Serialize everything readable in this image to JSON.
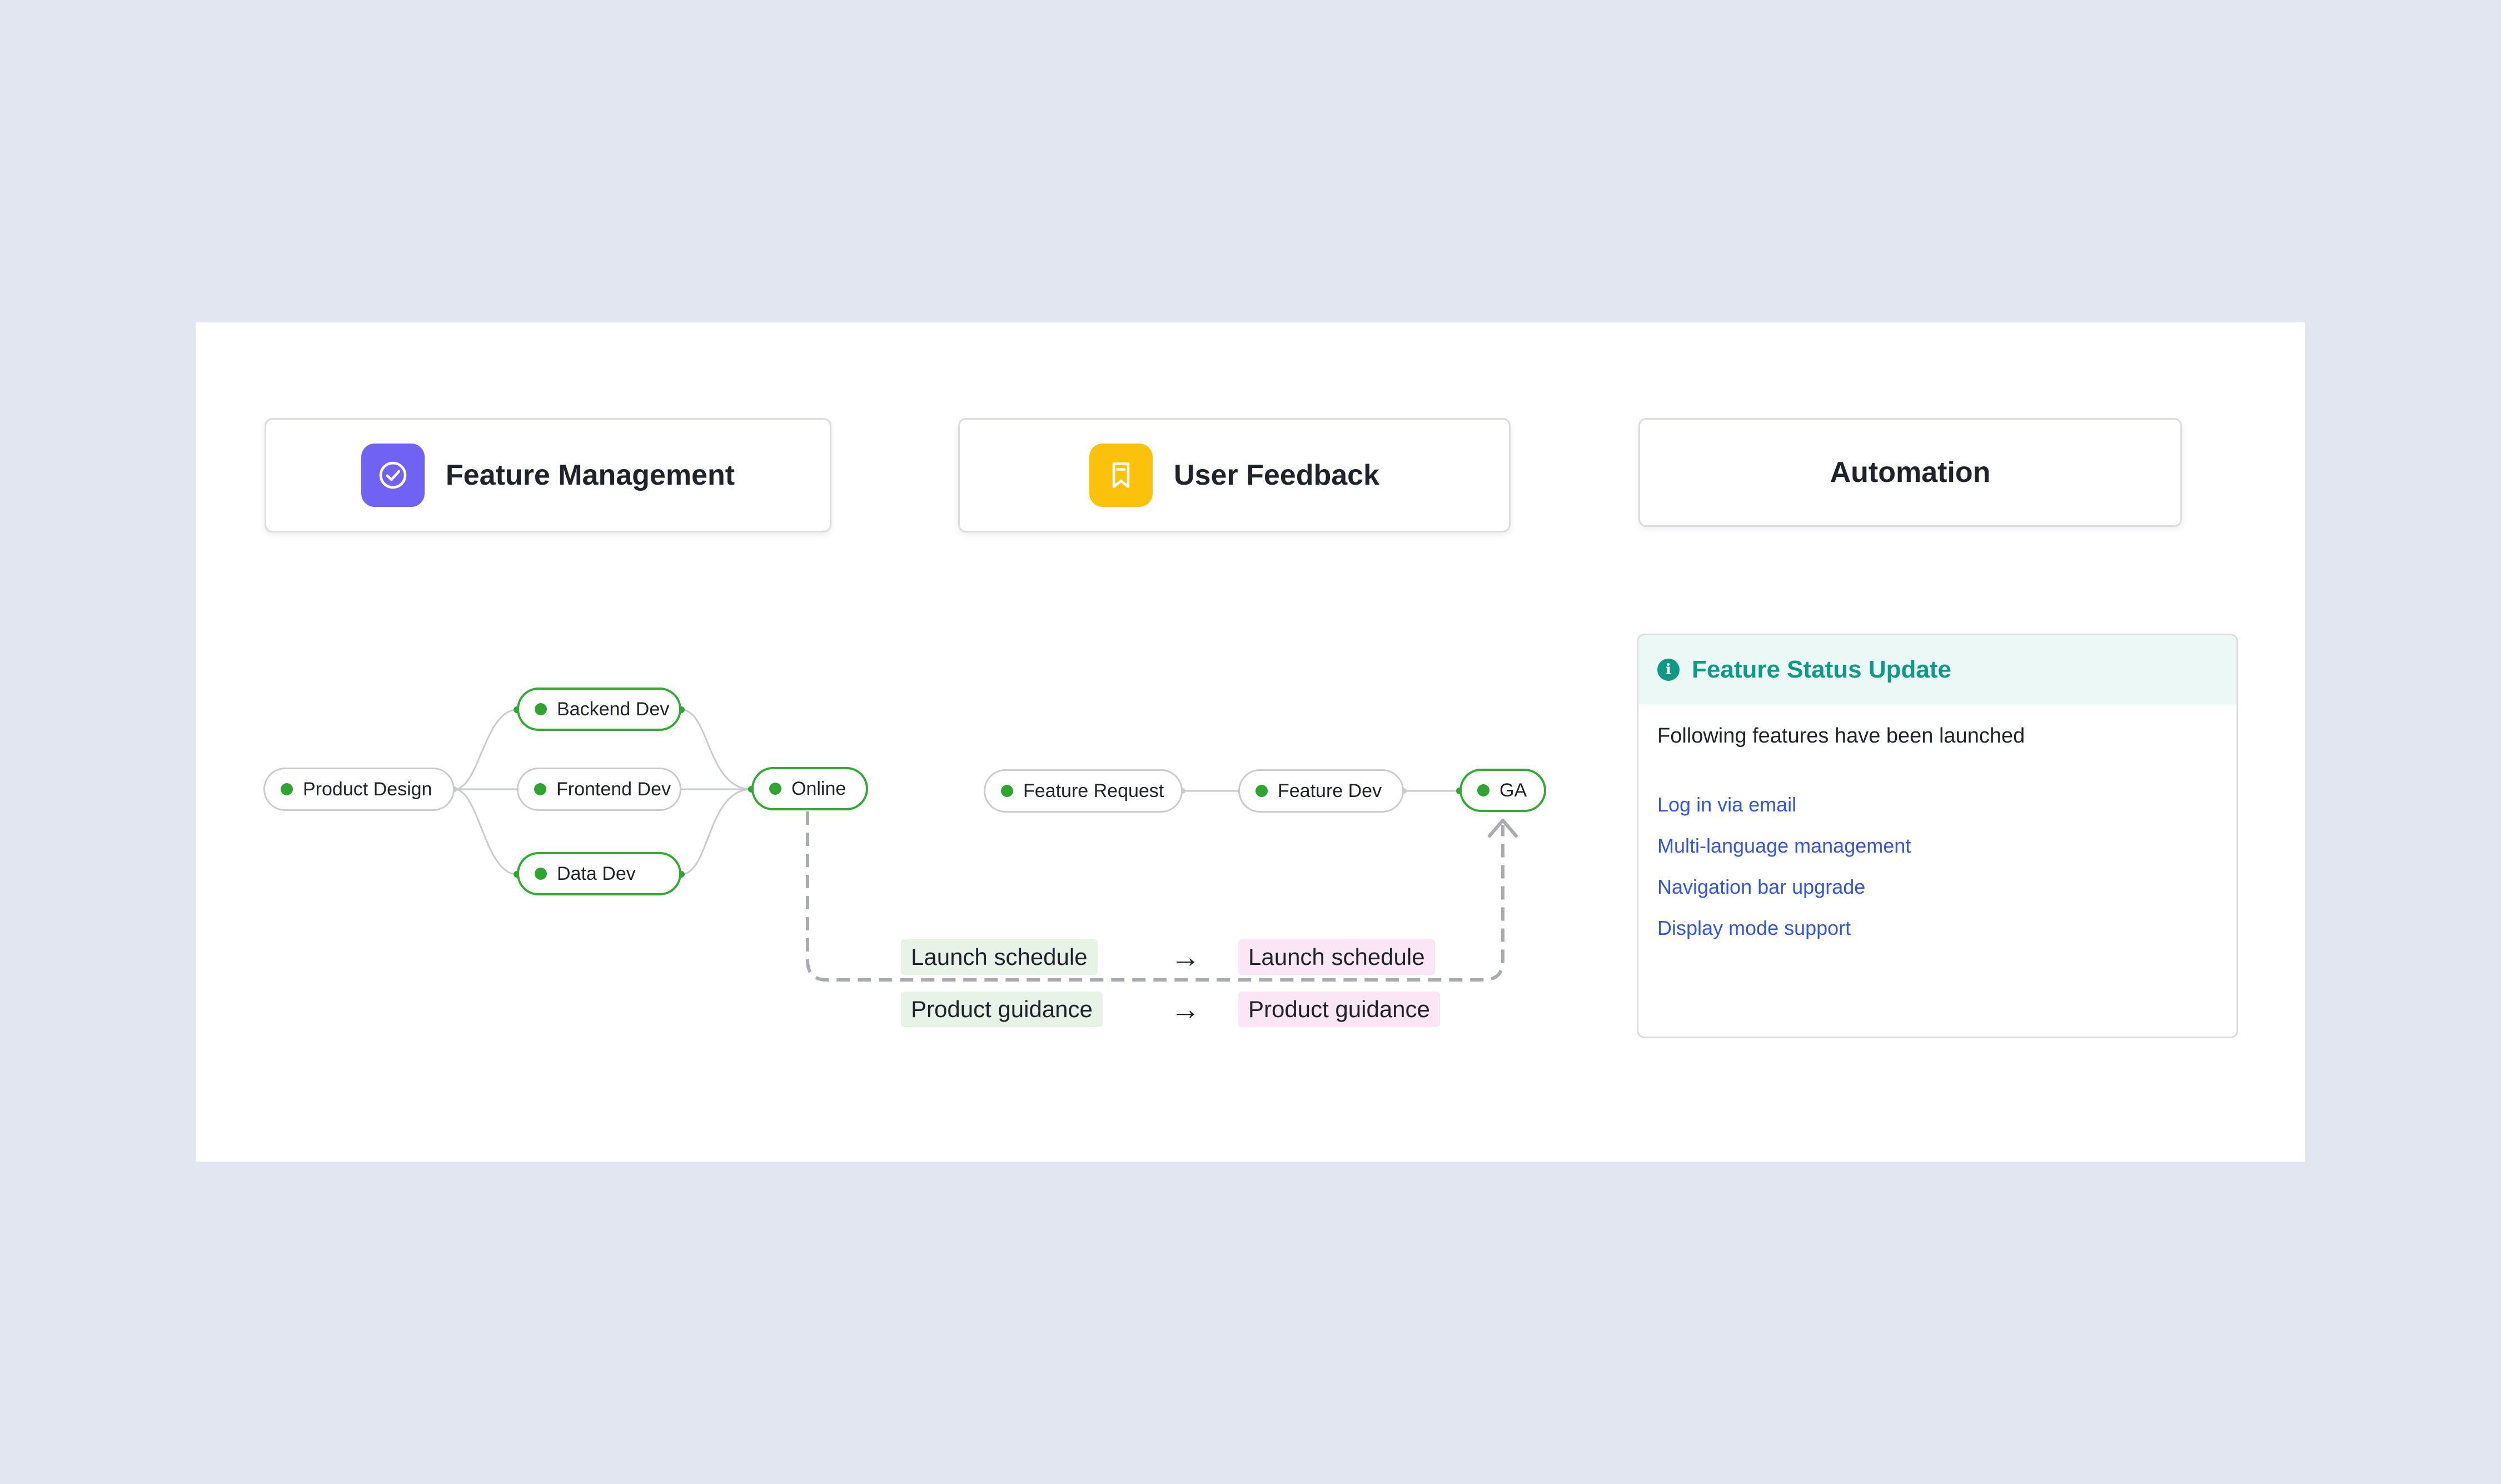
{
  "header_cards": {
    "feature_management": {
      "title": "Feature Management",
      "icon": "check-circle-icon",
      "icon_color": "#7062f2"
    },
    "user_feedback": {
      "title": "User Feedback",
      "icon": "bookmark-icon",
      "icon_color": "#fcc20b"
    },
    "automation": {
      "title": "Automation"
    }
  },
  "workflow": {
    "product_design": "Product Design",
    "backend_dev": "Backend Dev",
    "frontend_dev": "Frontend Dev",
    "data_dev": "Data Dev",
    "online": "Online",
    "status_dot_color": "#2fa52f"
  },
  "feedback_flow": {
    "feature_request": "Feature Request",
    "feature_dev": "Feature Dev",
    "ga": "GA"
  },
  "sync_fields": [
    {
      "source": "Launch schedule",
      "target": "Launch schedule"
    },
    {
      "source": "Product guidance",
      "target": "Product guidance"
    }
  ],
  "notice": {
    "title": "Feature Status Update",
    "icon": "info-icon",
    "accent_color": "#0f9a85",
    "description": "Following features have been launched",
    "links": [
      "Log in via email",
      "Multi-language management",
      "Navigation bar upgrade",
      "Display mode support"
    ]
  }
}
